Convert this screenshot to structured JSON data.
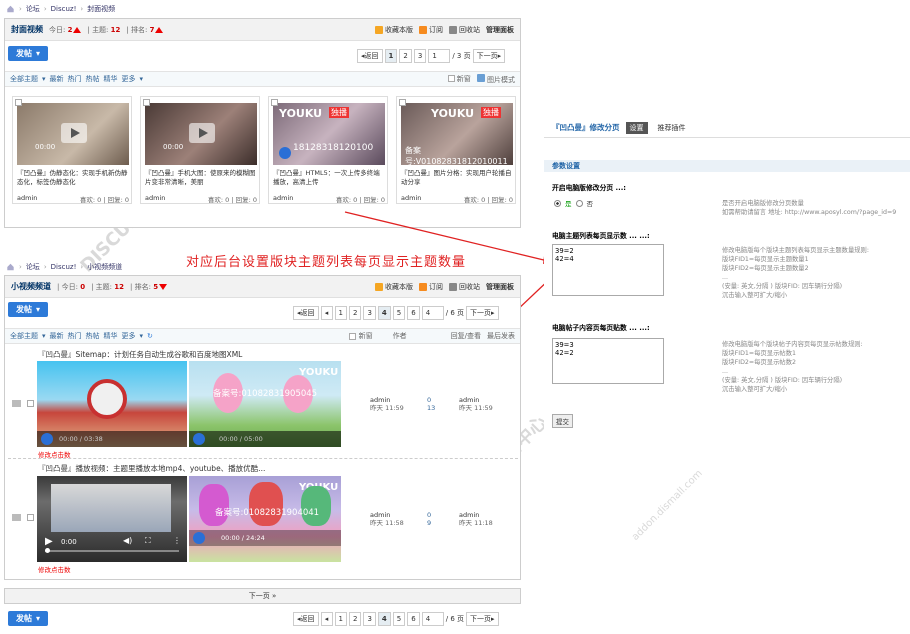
{
  "top": {
    "breadcrumb": [
      "论坛",
      "Discuz!",
      "封面视频"
    ],
    "forum": {
      "name": "封面视频",
      "today_label": "今日:",
      "today_value": "2",
      "topics_label": "主题:",
      "topics_value": "12",
      "rank_label": "排名:",
      "rank_value": "7",
      "actions": [
        "收藏本版",
        "订阅",
        "回收站",
        "管理面板"
      ]
    },
    "post_button": "发帖",
    "pager": {
      "back": "返回",
      "pages": [
        "1",
        "2",
        "3"
      ],
      "input": "1",
      "total": "/ 3 页",
      "next": "下一页"
    },
    "filter": {
      "items": [
        "全部主题",
        "最新",
        "热门",
        "热帖",
        "精华",
        "更多"
      ],
      "new_window": "新窗",
      "pic_mode": "图片模式"
    },
    "cards": [
      {
        "title": "『凹凸曼』伪静态化：实现手机新伪静态化，标签伪静态化",
        "author": "admin",
        "likes": "喜欢: 0",
        "replies": "回复: 0",
        "time": "00:00"
      },
      {
        "title": "『凹凸曼』手机大图：使原来的模糊图片变非常清晰，美丽",
        "author": "admin",
        "likes": "喜欢: 0",
        "replies": "回复: 0",
        "time": "00:00"
      },
      {
        "title": "『凹凸曼』HTML5：一次上传多终端播放，高清上传",
        "author": "admin",
        "likes": "喜欢: 0",
        "replies": "回复: 0",
        "overlay": "18128318120100",
        "brand": "YOUKU",
        "brand2": "独播"
      },
      {
        "title": "『凹凸曼』图片分格：实现用户轮播自动分享",
        "author": "admin",
        "likes": "喜欢: 0",
        "replies": "回复: 0",
        "overlay": "备案号:V01082831812010011",
        "brand": "YOUKU",
        "brand2": "独播"
      }
    ]
  },
  "annotation": "对应后台设置版块主题列表每页显示主题数量",
  "bottom": {
    "breadcrumb": [
      "论坛",
      "Discuz!",
      "小视频频道"
    ],
    "forum": {
      "name": "小视频频道",
      "today_label": "今日:",
      "today_value": "0",
      "topics_label": "主题:",
      "topics_value": "12",
      "rank_label": "排名:",
      "rank_value": "5",
      "actions": [
        "收藏本版",
        "订阅",
        "回收站",
        "管理面板"
      ]
    },
    "post_button": "发帖",
    "pager": {
      "back": "返回",
      "pages": [
        "1",
        "2",
        "3",
        "4",
        "5",
        "6"
      ],
      "current": "4",
      "input": "4",
      "total": "/ 6 页",
      "next": "下一页"
    },
    "filter": {
      "items": [
        "全部主题",
        "最新",
        "热门",
        "热帖",
        "精华",
        "更多"
      ],
      "new_window": "新窗",
      "author": "作者",
      "replies": "回复/查看",
      "last": "最后发表"
    },
    "threads": [
      {
        "title": "『凹凸曼』Sitemap：计划任务自动生成谷歌和百度地图XML",
        "video1_time": "00:00 / 03:38",
        "video2_time": "00:00 / 05:00",
        "video2_overlay": "备案号:01082831905045",
        "brand": "YOUKU",
        "tag": "修改点击数",
        "author": "admin",
        "author_time": "昨天 11:59",
        "replies": "0",
        "views": "13",
        "last_author": "admin",
        "last_time": "昨天 11:59"
      },
      {
        "title": "『凹凸曼』播放视频：主题里播放本地mp4、youtube、播放优酷...",
        "video1_time": "0:00",
        "video2_time": "00:00 / 24:24",
        "video2_overlay": "备案号:01082831904041",
        "brand": "YOUKU",
        "tag": "修改点击数",
        "author": "admin",
        "author_time": "昨天 11:58",
        "replies": "0",
        "views": "9",
        "last_author": "admin",
        "last_time": "昨天 11:18"
      }
    ],
    "next_page_bar": "下一页 »",
    "pager2": {
      "back": "返回",
      "pages": [
        "1",
        "2",
        "3",
        "4",
        "5",
        "6"
      ],
      "current": "4",
      "input": "4",
      "total": "/ 6 页",
      "next": "下一页"
    }
  },
  "settings": {
    "title": "『凹凸曼』修改分页",
    "tabs": [
      "设置",
      "推荐插件"
    ],
    "section": "参数设置",
    "enable_label": "开启电脑版修改分页 ...:",
    "radio_yes": "是",
    "radio_no": "否",
    "enable_help": "是否开启电脑版修改分页数量\n如需帮助请留言 地址: http://www.aposyl.com/?page_id=9",
    "topic_label": "电脑主题列表每页显示数 ... ...:",
    "topic_value": "39=2\n42=4",
    "topic_help": "修改电脑版每个版块主题列表每页显示主题数量规则:\n版块FID1=每页显示主题数量1\n版块FID2=每页显示主题数量2\n...\n(安量: 英文,分隔 ) 版块FID: 因车辆行分隔)\n沉击输入整可扩大/缩小",
    "post_label": "电脑帖子内容页每页贴数 ... ...:",
    "post_value": "39=3\n42=2",
    "post_help": "修改电脑版每个版块帖子内容页每页显示帖数规则:\n版块FID1=每页显示帖数1\n版块FID2=每页显示帖数2\n...\n(安量: 英文,分隔 ) 版块FID: 因车辆行分隔)\n沉击输入整可扩大/缩小",
    "submit": "提交"
  },
  "colors": {
    "accent": "#2d7ad8",
    "red": "#e02222",
    "title_blue": "#2366a8"
  }
}
